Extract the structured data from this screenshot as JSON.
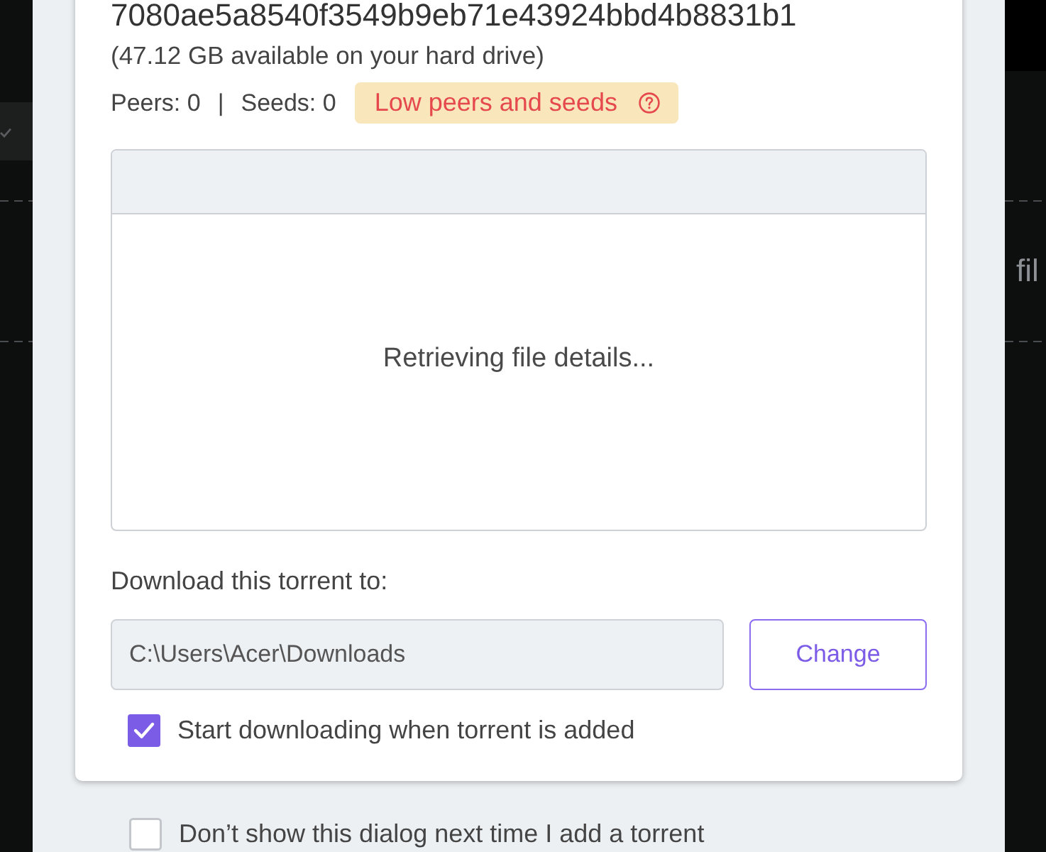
{
  "background": {
    "partial_text": "fil"
  },
  "dialog": {
    "info_hash": "7080ae5a8540f3549b9eb71e43924bbd4b8831b1",
    "free_space": "(47.12 GB available on your hard drive)",
    "peers": "Peers: 0",
    "separator": "|",
    "seeds": "Seeds: 0",
    "warning_badge": "Low peers and seeds",
    "file_list": {
      "status": "Retrieving file details..."
    },
    "destination": {
      "label": "Download this torrent to:",
      "path": "C:\\Users\\Acer\\Downloads",
      "button": "Change"
    },
    "options": [
      {
        "label": "Start downloading when torrent is added",
        "checked": true
      }
    ]
  },
  "footer_options": [
    {
      "label": "Don’t show this dialog next time I add a torrent",
      "checked": false
    }
  ]
}
